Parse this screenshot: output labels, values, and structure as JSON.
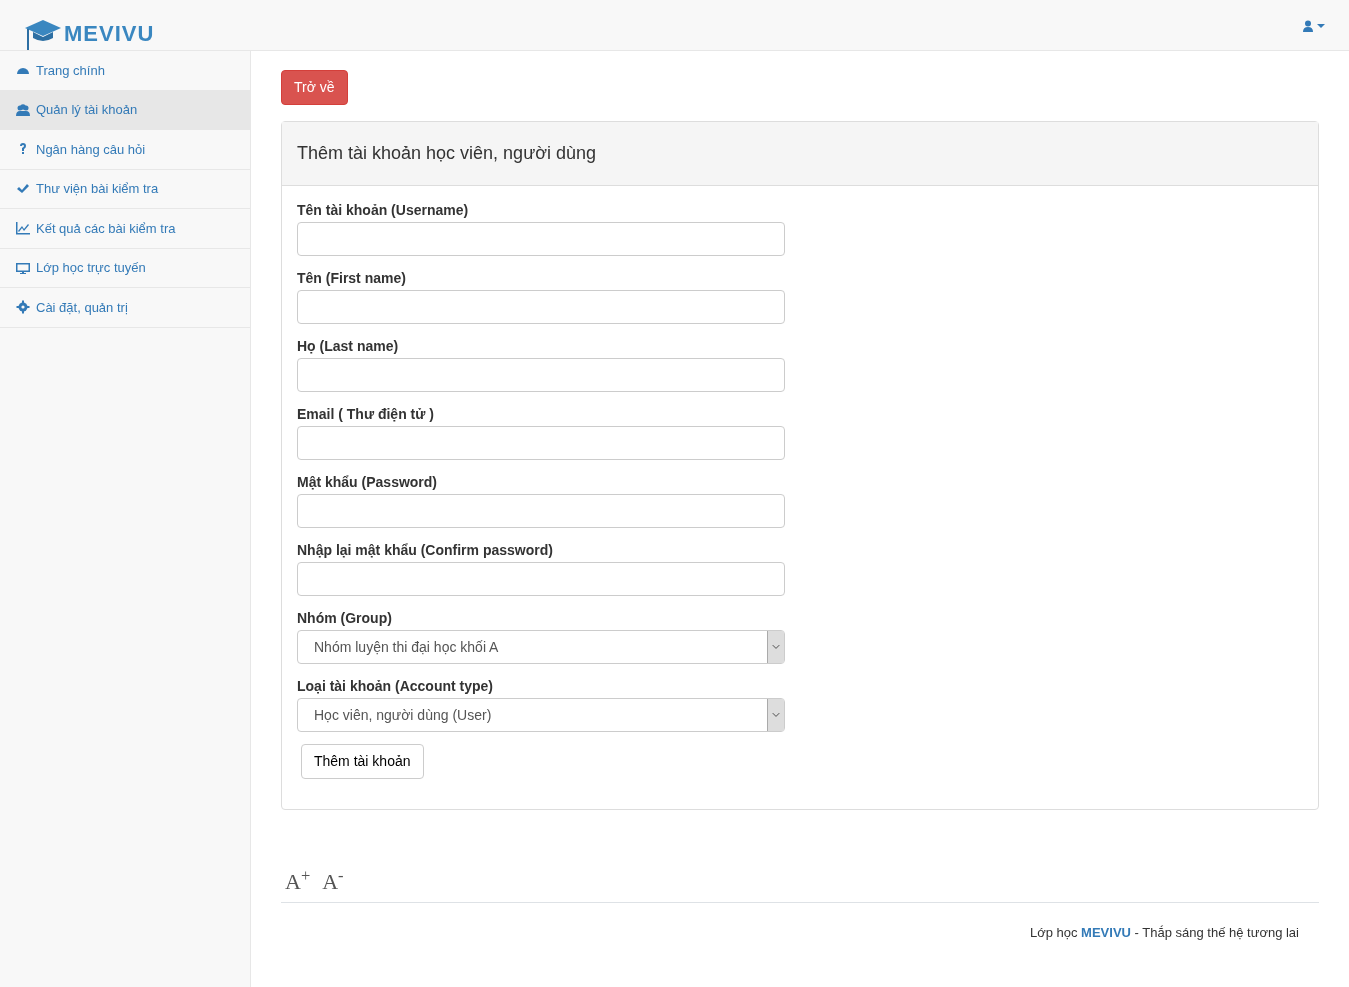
{
  "brand": {
    "name": "MEVIVU"
  },
  "sidebar": {
    "items": [
      {
        "label": "Trang chính",
        "selected": false
      },
      {
        "label": "Quản lý tài khoản",
        "selected": true
      },
      {
        "label": "Ngân hàng câu hỏi",
        "selected": false
      },
      {
        "label": "Thư viện bài kiểm tra",
        "selected": false
      },
      {
        "label": "Kết quả các bài kiểm tra",
        "selected": false
      },
      {
        "label": "Lớp học trực tuyến",
        "selected": false
      },
      {
        "label": "Cài đặt, quản trị",
        "selected": false
      }
    ]
  },
  "back_button": "Trở về",
  "panel": {
    "title": "Thêm tài khoản học viên, người dùng",
    "fields": [
      {
        "kind": "text",
        "label": "Tên tài khoản (Username)"
      },
      {
        "kind": "text",
        "label": "Tên (First name)"
      },
      {
        "kind": "text",
        "label": "Họ (Last name)"
      },
      {
        "kind": "text",
        "label": "Email ( Thư điện tử )"
      },
      {
        "kind": "password",
        "label": "Mật khẩu (Password)"
      },
      {
        "kind": "password",
        "label": "Nhập lại mật khẩu (Confirm password)"
      },
      {
        "kind": "select",
        "label": "Nhóm (Group)",
        "value": "Nhóm luyện thi đại học khối A"
      },
      {
        "kind": "select",
        "label": "Loại tài khoản (Account type)",
        "value": "Học viên, người dùng (User)"
      }
    ],
    "submit": "Thêm tài khoản"
  },
  "font_controls": [
    "A$^{+}$",
    "A$^{-}$"
  ],
  "footer": "Lớp học **MEVIVU** - Thắp sáng thế hệ tương lai"
}
